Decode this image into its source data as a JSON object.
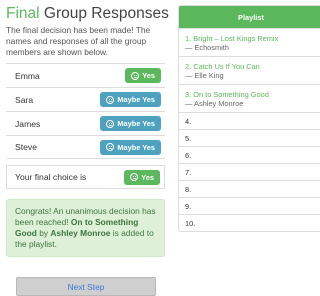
{
  "header": {
    "title_accent": "Final",
    "title_rest": " Group Responses",
    "description": "The final decision has been made! The names and responses of all the group members are shown below."
  },
  "responses": [
    {
      "name": "Emma",
      "response": "Yes",
      "type": "yes"
    },
    {
      "name": "Sara",
      "response": "Maybe Yes",
      "type": "maybe"
    },
    {
      "name": "James",
      "response": "Maybe Yes",
      "type": "maybe"
    },
    {
      "name": "Steve",
      "response": "Maybe Yes",
      "type": "maybe"
    }
  ],
  "final": {
    "label": "Your final choice is",
    "choice": "Yes"
  },
  "alert": {
    "pre": "Congrats! An unanimous decision has been reached! ",
    "song": "On to Something Good",
    "mid": " by ",
    "artist": "Ashley Monroe",
    "post": " is added to the playlist."
  },
  "next_button": "Next Step",
  "playlist": {
    "header": "Playlist",
    "items": [
      {
        "num": "1.",
        "title": "Bright – Lost Kings Remix",
        "artist": "— Echosmith"
      },
      {
        "num": "2.",
        "title": "Catch Us If You Can",
        "artist": "— Elle King"
      },
      {
        "num": "3.",
        "title": "On to Something Good",
        "artist": "— Ashley Monroe"
      },
      {
        "num": "4.",
        "title": "",
        "artist": ""
      },
      {
        "num": "5.",
        "title": "",
        "artist": ""
      },
      {
        "num": "6.",
        "title": "",
        "artist": ""
      },
      {
        "num": "7.",
        "title": "",
        "artist": ""
      },
      {
        "num": "8.",
        "title": "",
        "artist": ""
      },
      {
        "num": "9.",
        "title": "",
        "artist": ""
      },
      {
        "num": "10.",
        "title": "",
        "artist": ""
      }
    ]
  },
  "colors": {
    "green": "#5cb85c",
    "info": "#4fa1c0",
    "alert_bg": "#dff0d8",
    "link": "#3a7bd5"
  },
  "icons": {
    "response_badge": "smiley-icon"
  }
}
